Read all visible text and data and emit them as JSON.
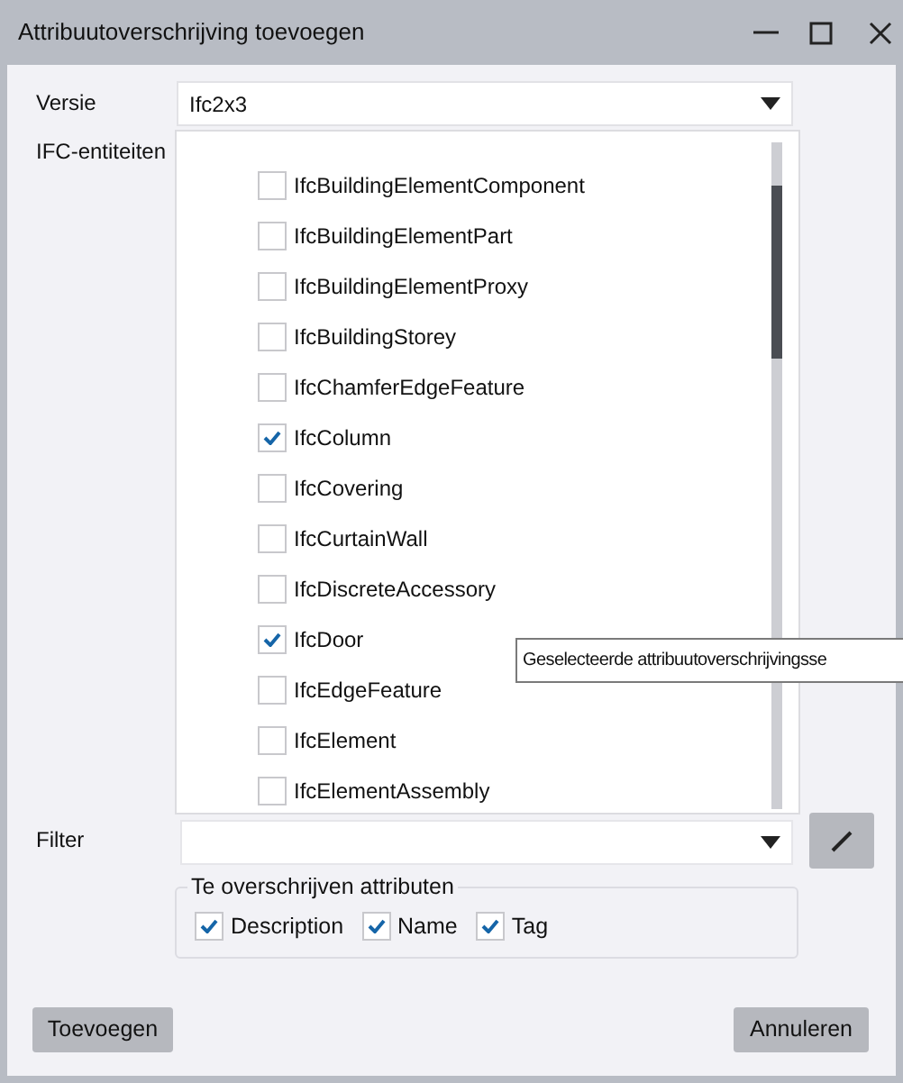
{
  "window": {
    "title": "Attribuutoverschrijving toevoegen"
  },
  "version": {
    "label": "Versie",
    "value": "Ifc2x3"
  },
  "entities": {
    "label": "IFC-entiteiten",
    "items": [
      {
        "label": "IfcBuildingElementComponent",
        "checked": false
      },
      {
        "label": "IfcBuildingElementPart",
        "checked": false
      },
      {
        "label": "IfcBuildingElementProxy",
        "checked": false
      },
      {
        "label": "IfcBuildingStorey",
        "checked": false
      },
      {
        "label": "IfcChamferEdgeFeature",
        "checked": false
      },
      {
        "label": "IfcColumn",
        "checked": true
      },
      {
        "label": "IfcCovering",
        "checked": false
      },
      {
        "label": "IfcCurtainWall",
        "checked": false
      },
      {
        "label": "IfcDiscreteAccessory",
        "checked": false
      },
      {
        "label": "IfcDoor",
        "checked": true
      },
      {
        "label": "IfcEdgeFeature",
        "checked": false
      },
      {
        "label": "IfcElement",
        "checked": false
      },
      {
        "label": "IfcElementAssembly",
        "checked": false
      }
    ]
  },
  "tooltip": "Geselecteerde attribuutoverschrijvingsse",
  "filter": {
    "label": "Filter"
  },
  "attributes": {
    "title": "Te overschrijven attributen",
    "items": [
      {
        "label": "Description",
        "checked": true
      },
      {
        "label": "Name",
        "checked": true
      },
      {
        "label": "Tag",
        "checked": true
      }
    ]
  },
  "buttons": [
    "Toevoegen",
    "Annuleren"
  ]
}
